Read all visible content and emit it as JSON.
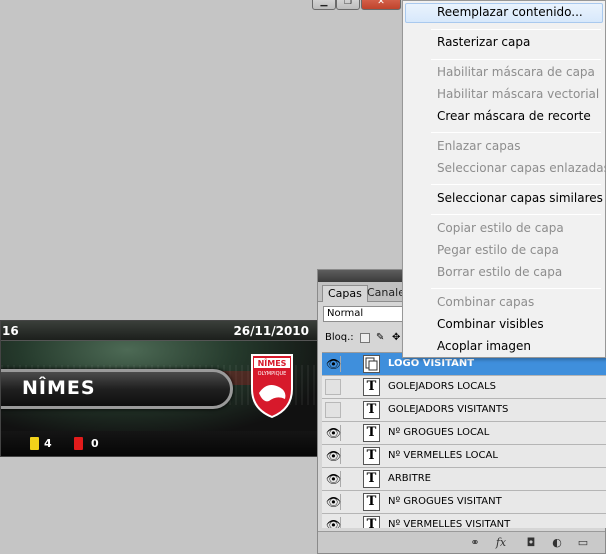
{
  "window_controls": {
    "minimize": "▁",
    "maximize": "❐",
    "close": "✕"
  },
  "scoreboard": {
    "round": "16",
    "date": "26/11/2010",
    "team": "NÎMES",
    "logo_text": "NÎMES",
    "logo_subtext": "OLYMPIQUE",
    "yellow_cards": "4",
    "red_cards": "0",
    "colors": {
      "yellow_card": "#f2d21a",
      "red_card": "#e21b1b",
      "logo_red": "#d7192b"
    }
  },
  "layers_panel": {
    "tabs": [
      "Capas",
      "Canales"
    ],
    "blend_mode": "Normal",
    "lock_label": "Bloq.:",
    "layers": [
      {
        "name": "LOGO VISITANT",
        "visible": true,
        "selected": true,
        "type": "smart-object"
      },
      {
        "name": "GOLEJADORS LOCALS",
        "visible": false,
        "selected": false,
        "type": "text"
      },
      {
        "name": "GOLEJADORS VISITANTS",
        "visible": false,
        "selected": false,
        "type": "text"
      },
      {
        "name": "Nº GROGUES LOCAL",
        "visible": true,
        "selected": false,
        "type": "text"
      },
      {
        "name": "Nº VERMELLES LOCAL",
        "visible": true,
        "selected": false,
        "type": "text"
      },
      {
        "name": "ARBITRE",
        "visible": true,
        "selected": false,
        "type": "text"
      },
      {
        "name": "Nº GROGUES VISITANT",
        "visible": true,
        "selected": false,
        "type": "text"
      },
      {
        "name": "Nº VERMELLES VISITANT",
        "visible": true,
        "selected": false,
        "type": "text"
      }
    ],
    "thumb_text_glyph": "T",
    "eye_glyph": "👁",
    "bottom_icons": [
      "link-icon",
      "fx-icon",
      "mask-icon",
      "adjustment-icon",
      "folder-icon"
    ],
    "bottom_labels": {
      "link": "⚭",
      "fx": "fx",
      "mask": "◘",
      "adjustment": "◐",
      "folder": "▭"
    }
  },
  "context_menu": {
    "items": [
      {
        "label": "Reemplazar contenido...",
        "enabled": true,
        "highlighted": true
      },
      {
        "label": "Rasterizar capa",
        "enabled": true
      },
      {
        "label": "Habilitar máscara de capa",
        "enabled": false
      },
      {
        "label": "Habilitar máscara vectorial",
        "enabled": false
      },
      {
        "label": "Crear máscara de recorte",
        "enabled": true
      },
      {
        "label": "Enlazar capas",
        "enabled": false
      },
      {
        "label": "Seleccionar capas enlazadas",
        "enabled": false
      },
      {
        "label": "Seleccionar capas similares",
        "enabled": true
      },
      {
        "label": "Copiar estilo de capa",
        "enabled": false
      },
      {
        "label": "Pegar estilo de capa",
        "enabled": false
      },
      {
        "label": "Borrar estilo de capa",
        "enabled": false
      },
      {
        "label": "Combinar capas",
        "enabled": false
      },
      {
        "label": "Combinar visibles",
        "enabled": true
      },
      {
        "label": "Acoplar imagen",
        "enabled": true
      }
    ]
  }
}
